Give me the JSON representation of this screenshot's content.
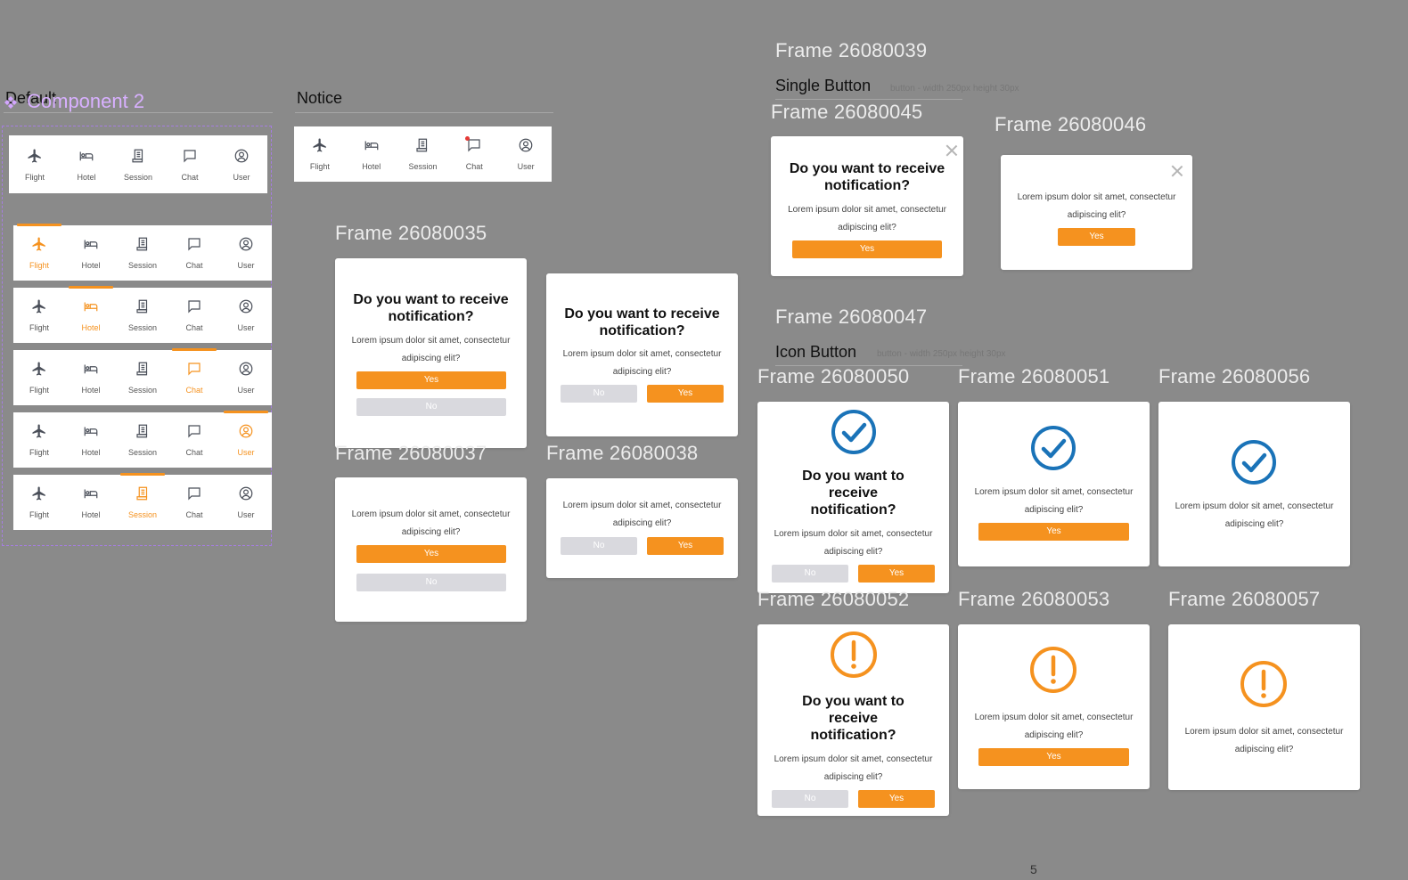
{
  "canvas": {
    "component_title": "Component 2",
    "default_label": "Default",
    "notice_label": "Notice",
    "bottom_marker": "5"
  },
  "colors": {
    "accent": "#f5921f",
    "check": "#1a73b8",
    "no_button": "#d9d9de",
    "badge": "#e53935"
  },
  "nav": {
    "items": [
      {
        "label": "Flight",
        "icon": "plane-icon"
      },
      {
        "label": "Hotel",
        "icon": "bed-icon"
      },
      {
        "label": "Session",
        "icon": "session-icon"
      },
      {
        "label": "Chat",
        "icon": "chat-icon"
      },
      {
        "label": "User",
        "icon": "user-icon"
      }
    ]
  },
  "frames": {
    "f35": "Frame 26080035",
    "f37": "Frame 26080037",
    "f38": "Frame 26080038",
    "f39": "Frame 26080039",
    "f45": "Frame 26080045",
    "f46": "Frame 26080046",
    "f47": "Frame 26080047",
    "f50": "Frame 26080050",
    "f51": "Frame 26080051",
    "f52": "Frame 26080052",
    "f53": "Frame 26080053",
    "f56": "Frame 26080056",
    "f57": "Frame 26080057"
  },
  "sections": {
    "single_button": "Single Button",
    "icon_button": "Icon Button",
    "single_hint": "button - width 250px height 30px",
    "icon_hint": "button - width 250px height 30px"
  },
  "dialog": {
    "title_line1": "Do you want to receive",
    "title_line2": "notification?",
    "title_wrap1": "Do you want to",
    "title_wrap2": "receive",
    "title_wrap3": "notification?",
    "body_line1": "Lorem ipsum dolor sit amet, consectetur",
    "body_line2": "adipiscing elit?",
    "yes": "Yes",
    "no": "No"
  }
}
